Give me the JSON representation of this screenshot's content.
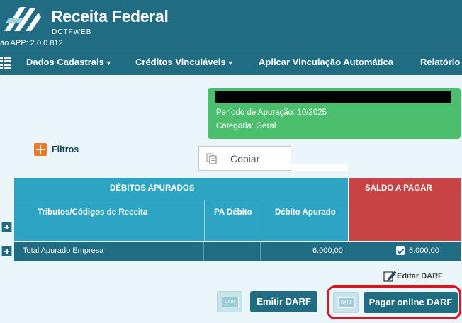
{
  "header": {
    "brand_title": "Receita Federal",
    "brand_sub": "DCTFWEB",
    "version": "ão APP: 2.0.0.812",
    "logo_icon": "receita-federal-logo-icon"
  },
  "nav": {
    "menu_icon": "menu-icon",
    "items": [
      {
        "label": "Dados Cadastrais",
        "dropdown": true
      },
      {
        "label": "Créditos Vinculáveis",
        "dropdown": true
      },
      {
        "label": "Aplicar Vinculação Automática",
        "dropdown": false
      },
      {
        "label": "Relatório",
        "dropdown": false
      }
    ]
  },
  "info": {
    "periodo": "Período de Apuração: 10/2025",
    "categoria": "Categoria: Geral",
    "color": "#4cbf6e"
  },
  "filters": {
    "label": "Filtros",
    "icon": "plus-square-icon"
  },
  "copy_popup": {
    "label": "Copiar",
    "icon": "copy-icon"
  },
  "table": {
    "group_header": "DÉBITOS APURADOS",
    "saldo_header": "SALDO A PAGAR",
    "columns": [
      "Tributos/Códigos de Receita",
      "PA Débito",
      "Débito Apurado"
    ],
    "rows": [
      {
        "label": "Total Apurado Empresa",
        "pa_debito": "",
        "debito_apurado": "6.000,00",
        "saldo": "6.000,00",
        "checked": true
      }
    ],
    "colors": {
      "header": "#2ea4c5",
      "saldo": "#c84343",
      "row": "#1f6c83"
    }
  },
  "actions": {
    "edit_label": "Editar DARF",
    "darf_icon_text": "DARF",
    "emitir_label": "Emitir DARF",
    "pagar_label": "Pagar online DARF"
  }
}
